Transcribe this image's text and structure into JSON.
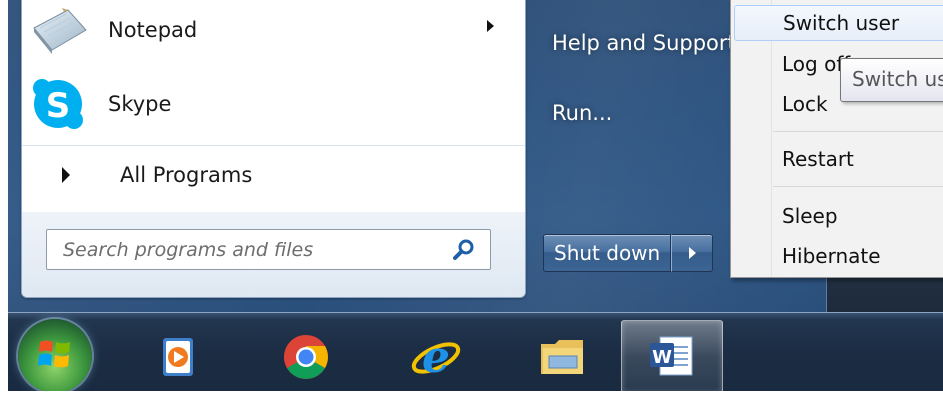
{
  "start_menu": {
    "pinned_programs": [
      {
        "label": "Notepad",
        "icon": "notepad-icon",
        "has_submenu": true
      },
      {
        "label": "Skype",
        "icon": "skype-icon",
        "has_submenu": false
      }
    ],
    "all_programs_label": "All Programs",
    "search": {
      "placeholder": "Search programs and files",
      "value": ""
    },
    "right_links": {
      "help": "Help and Support",
      "run": "Run..."
    },
    "shutdown": {
      "label": "Shut down",
      "options_icon": "arrow-right-icon"
    }
  },
  "power_menu": {
    "items": {
      "switch_user": "Switch user",
      "log_off": "Log off",
      "lock": "Lock",
      "restart": "Restart",
      "sleep": "Sleep",
      "hibernate": "Hibernate"
    },
    "highlighted": "Switch user"
  },
  "tooltip": {
    "text": "Switch user"
  },
  "taskbar": {
    "start_button_icon": "windows-logo-icon",
    "items": [
      {
        "name": "windows-media-player",
        "icon": "media-player-icon"
      },
      {
        "name": "google-chrome",
        "icon": "chrome-icon"
      },
      {
        "name": "internet-explorer",
        "icon": "internet-explorer-icon"
      },
      {
        "name": "windows-explorer",
        "icon": "folder-icon"
      },
      {
        "name": "microsoft-word",
        "icon": "word-icon",
        "active": true
      }
    ]
  },
  "colors": {
    "start_menu_glass": "#2a4f7b",
    "taskbar": "#1b2c43",
    "highlight_border": "#aecff7"
  }
}
